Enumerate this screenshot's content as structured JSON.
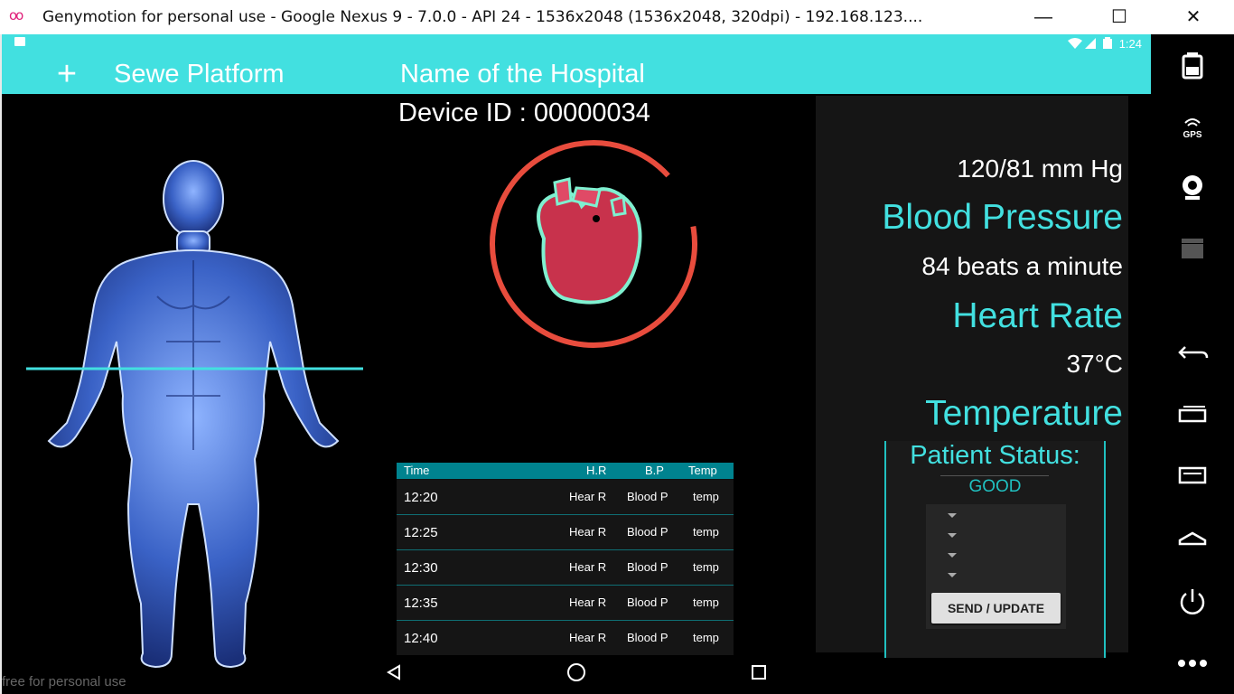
{
  "window": {
    "title": "Genymotion for personal use - Google Nexus 9 - 7.0.0 - API 24 - 1536x2048 (1536x2048, 320dpi) - 192.168.123....",
    "logo": "oo",
    "minimize_glyph": "—",
    "maximize_glyph": "☐",
    "close_glyph": "✕"
  },
  "status_bar": {
    "time": "1:24",
    "icons": [
      "wifi-icon",
      "signal-icon",
      "battery-icon"
    ]
  },
  "app_bar": {
    "add_glyph": "+",
    "title": "Sewe Platform",
    "hospital": "Name of the Hospital"
  },
  "device": {
    "id_text": "Device ID : 00000034"
  },
  "vitals": {
    "bp_value": "120/81 mm Hg",
    "bp_label": "Blood Pressure",
    "hr_value": "84 beats a minute",
    "hr_label": "Heart Rate",
    "temp_value": "37°C",
    "temp_label": "Temperature"
  },
  "patient_status": {
    "title": "Patient Status:",
    "value": "GOOD",
    "send_label": "SEND / UPDATE"
  },
  "readings_table": {
    "headers": [
      "Time",
      "H.R",
      "B.P",
      "Temp"
    ],
    "rows": [
      [
        "12:20",
        "Hear R",
        "Blood P",
        "temp"
      ],
      [
        "12:25",
        "Hear R",
        "Blood P",
        "temp"
      ],
      [
        "12:30",
        "Hear R",
        "Blood P",
        "temp"
      ],
      [
        "12:35",
        "Hear R",
        "Blood P",
        "temp"
      ],
      [
        "12:40",
        "Hear R",
        "Blood P",
        "temp"
      ]
    ]
  },
  "watermark": "free for personal use",
  "colors": {
    "accent": "#42e0e0",
    "ring": "#e84c3d",
    "table_header": "#00838f"
  },
  "side_toolbar": [
    "battery-icon",
    "gps-icon",
    "camera-icon",
    "video-icon",
    "back-icon",
    "recent-apps-icon",
    "menu-icon",
    "home-icon",
    "power-icon",
    "more-icon"
  ],
  "side_toolbar_gps_text": "GPS"
}
